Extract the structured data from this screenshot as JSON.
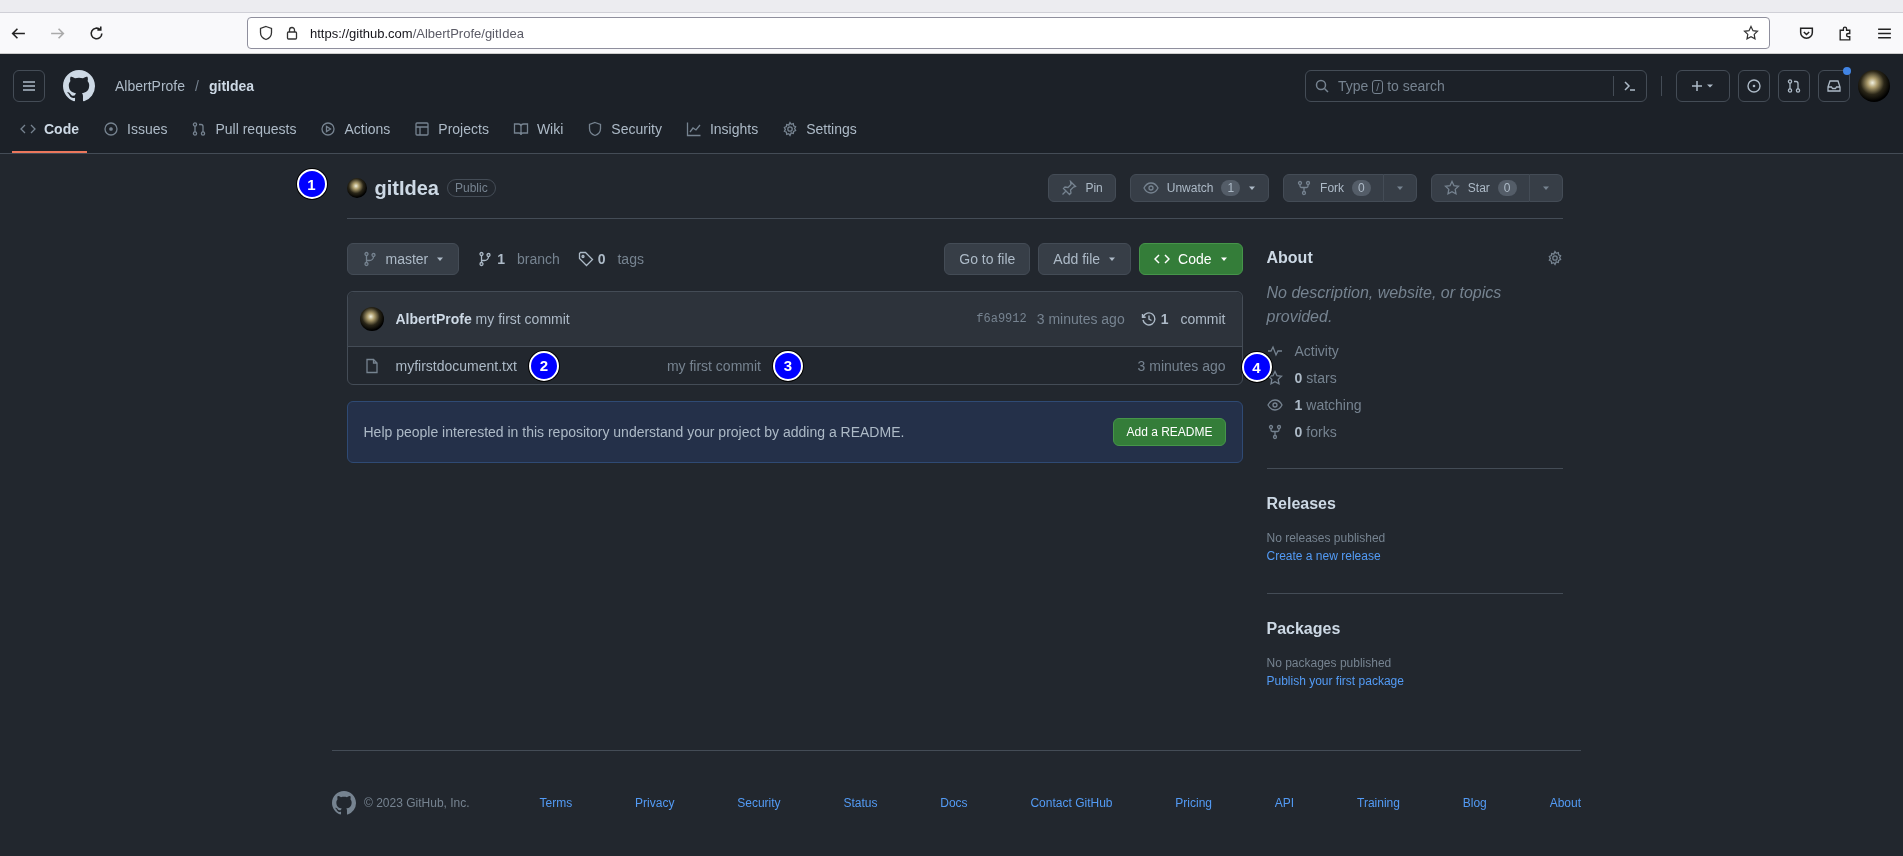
{
  "browser": {
    "url_host": "https://github.com",
    "url_path": "/AlbertProfe/gitIdea"
  },
  "header": {
    "owner": "AlbertProfe",
    "separator": "/",
    "repo": "gitIdea",
    "search": {
      "before": "Type",
      "key": "/",
      "after": "to search"
    },
    "notifications_unread": true
  },
  "nav_tabs": [
    {
      "label": "Code",
      "selected": true
    },
    {
      "label": "Issues",
      "selected": false
    },
    {
      "label": "Pull requests",
      "selected": false
    },
    {
      "label": "Actions",
      "selected": false
    },
    {
      "label": "Projects",
      "selected": false
    },
    {
      "label": "Wiki",
      "selected": false
    },
    {
      "label": "Security",
      "selected": false
    },
    {
      "label": "Insights",
      "selected": false
    },
    {
      "label": "Settings",
      "selected": false
    }
  ],
  "repo": {
    "marker": "1",
    "name": "gitIdea",
    "visibility": "Public",
    "actions": [
      {
        "kind": "pin",
        "label": "Pin"
      },
      {
        "kind": "watch",
        "label": "Unwatch",
        "count": "1"
      },
      {
        "kind": "fork",
        "label": "Fork",
        "count": "0"
      },
      {
        "kind": "star",
        "label": "Star",
        "count": "0"
      }
    ]
  },
  "branch_bar": {
    "branch": "master",
    "branches": {
      "count": "1",
      "label": "branch"
    },
    "tags": {
      "count": "0",
      "label": "tags"
    },
    "buttons": [
      {
        "kind": "plain",
        "label": "Go to file"
      },
      {
        "kind": "menu",
        "label": "Add file"
      },
      {
        "kind": "code",
        "label": "Code"
      }
    ]
  },
  "commit": {
    "author": "AlbertProfe",
    "message": "my first commit",
    "sha": "f6a9912",
    "time": "3 minutes ago",
    "count": "1",
    "count_label": "commit"
  },
  "files": [
    {
      "name": "myfirstdocument.txt",
      "name_marker": "2",
      "message": "my first commit",
      "message_marker": "3",
      "time": "3 minutes ago",
      "time_marker": "4"
    }
  ],
  "readme": {
    "text": "Help people interested in this repository understand your project by adding a README.",
    "button": "Add a README"
  },
  "about": {
    "title": "About",
    "description": "No description, website, or topics provided.",
    "stats": [
      {
        "kind": "activity",
        "label": "Activity"
      },
      {
        "kind": "star",
        "count": "0",
        "label": "stars"
      },
      {
        "kind": "eye",
        "count": "1",
        "label": "watching"
      },
      {
        "kind": "fork",
        "count": "0",
        "label": "forks"
      }
    ]
  },
  "releases": {
    "title": "Releases",
    "note": "No releases published",
    "link": "Create a new release"
  },
  "packages": {
    "title": "Packages",
    "note": "No packages published",
    "link": "Publish your first package"
  },
  "footer": {
    "copyright": "© 2023 GitHub, Inc.",
    "links": [
      "Terms",
      "Privacy",
      "Security",
      "Status",
      "Docs",
      "Contact GitHub",
      "Pricing",
      "API",
      "Training",
      "Blog",
      "About"
    ]
  }
}
